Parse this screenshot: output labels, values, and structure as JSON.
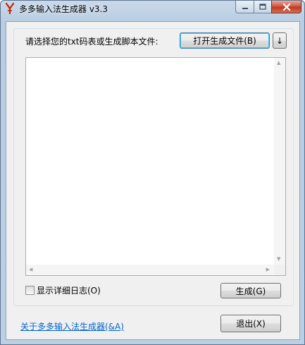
{
  "window": {
    "title": "多多输入法生成器 v3.3"
  },
  "caption": {
    "minimize_glyph": "▁",
    "maximize_glyph": "□",
    "close_glyph": "✕"
  },
  "main": {
    "prompt_label": "请选择您的txt码表或生成脚本文件:",
    "open_button_label": "打开生成文件(B)",
    "dropdown_arrow_label": "↓",
    "log_text": "",
    "show_log_checkbox": {
      "label": "显示详细日志(O)",
      "checked": false
    },
    "generate_button_label": "生成(G)"
  },
  "footer": {
    "about_link": "关于多多输入法生成器(&A)",
    "exit_button_label": "退出(X)"
  },
  "colors": {
    "link": "#0066cc",
    "close_button": "#c1391f",
    "app_icon": "#cc2200"
  },
  "icons": {
    "app_icon": "red-y-logo-icon"
  }
}
